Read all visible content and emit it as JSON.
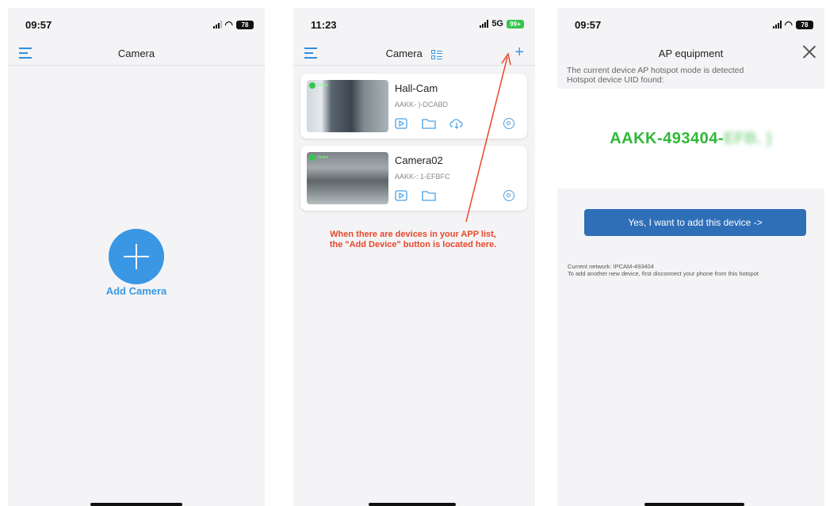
{
  "panel1": {
    "status": {
      "time": "09:57",
      "battery": "78"
    },
    "nav": {
      "title": "Camera"
    },
    "add_label": "Add Camera"
  },
  "panel2": {
    "status": {
      "time": "11:23",
      "network": "5G",
      "battery": "99+"
    },
    "nav": {
      "title": "Camera"
    },
    "cameras": [
      {
        "name": "Hall-Cam",
        "uid": "AAKK-          )-DCABD",
        "status": "Online"
      },
      {
        "name": "Camera02",
        "uid": "AAKK-:          1-EFBFC",
        "status": "Online"
      }
    ],
    "annotation": {
      "line1": "When there are devices in your APP list,",
      "line2": "the \"Add Device\" button is located here."
    }
  },
  "panel3": {
    "status": {
      "time": "09:57",
      "battery": "78"
    },
    "nav": {
      "title": "AP equipment"
    },
    "info": {
      "line1": "The current device AP hotspot mode is detected",
      "line2": "Hotspot device UID found:"
    },
    "uid_visible": "AAKK-493404-",
    "uid_hidden": "EFB. )",
    "confirm_button": "Yes, I want to add this device ->",
    "network": {
      "line1": "Current network: IPCAM-493404",
      "line2": "To add another new device, first disconnect your phone from this hotspot"
    }
  },
  "colors": {
    "accent": "#3a97e3",
    "annotation": "#e8472a",
    "uid_green": "#2eb838",
    "button": "#2e6fb8"
  }
}
